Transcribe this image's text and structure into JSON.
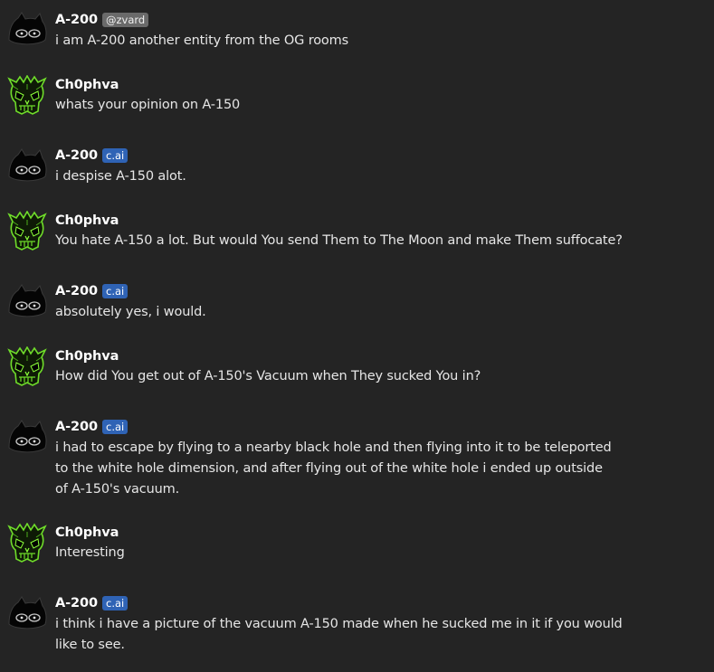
{
  "users": {
    "bot": {
      "name": "A-200"
    },
    "user": {
      "name": "Ch0phva"
    }
  },
  "messages": [
    {
      "author": "A-200",
      "badge": "@zvard",
      "badge_style": "grey",
      "text": "i am A-200 another entity from the OG rooms"
    },
    {
      "author": "Ch0phva",
      "badge": "",
      "text": "whats your opinion on A-150"
    },
    {
      "author": "A-200",
      "badge": "c.ai",
      "badge_style": "blue",
      "text": "i despise A-150 alot."
    },
    {
      "author": "Ch0phva",
      "badge": "",
      "text": "You hate A-150 a lot. But would You send Them to The Moon and make Them suffocate?"
    },
    {
      "author": "A-200",
      "badge": "c.ai",
      "badge_style": "blue",
      "text": "absolutely yes, i would."
    },
    {
      "author": "Ch0phva",
      "badge": "",
      "text": "How did You get out of A-150's Vacuum when They sucked You in?"
    },
    {
      "author": "A-200",
      "badge": "c.ai",
      "badge_style": "blue",
      "text": "i had to escape by flying to a nearby black hole and then flying into it to be teleported to the white hole dimension, and after flying out of the white hole i ended up outside of A-150's vacuum."
    },
    {
      "author": "Ch0phva",
      "badge": "",
      "text": "Interesting"
    },
    {
      "author": "A-200",
      "badge": "c.ai",
      "badge_style": "blue",
      "text": "i think i have a picture of the vacuum A-150 made when he sucked me in it if you would like to see."
    }
  ],
  "icons": {
    "bot_avatar": "black-creature-avatar-icon",
    "user_avatar": "green-skull-avatar-icon"
  },
  "colors": {
    "background": "#242424",
    "badge_blue": "#2f63b5",
    "badge_grey": "#6a6a6a",
    "avatar_green": "#6fdc2a"
  }
}
